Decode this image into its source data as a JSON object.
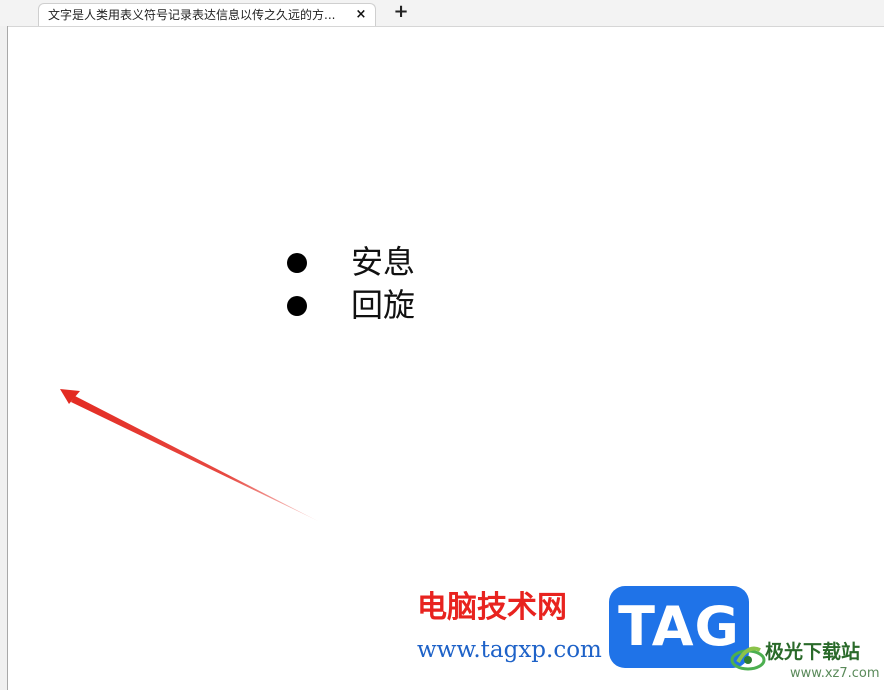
{
  "tab": {
    "title": "文字是人类用表义符号记录表达信息以传之久远的方...",
    "close_glyph": "×",
    "new_tab_glyph": "+"
  },
  "document": {
    "bullets": [
      {
        "text": "安息"
      },
      {
        "text": "回旋"
      }
    ],
    "arrow_color": "#e32a21"
  },
  "watermark": {
    "brand_cn": "电脑技术网",
    "brand_url": "www.tagxp.com",
    "badge": "TAG",
    "site_name": "极光下载站",
    "site_url": "www.xz7.com",
    "colors": {
      "brand_red": "#e8231f",
      "badge_blue": "#1f73e8",
      "url_blue": "#1e62c8"
    }
  }
}
